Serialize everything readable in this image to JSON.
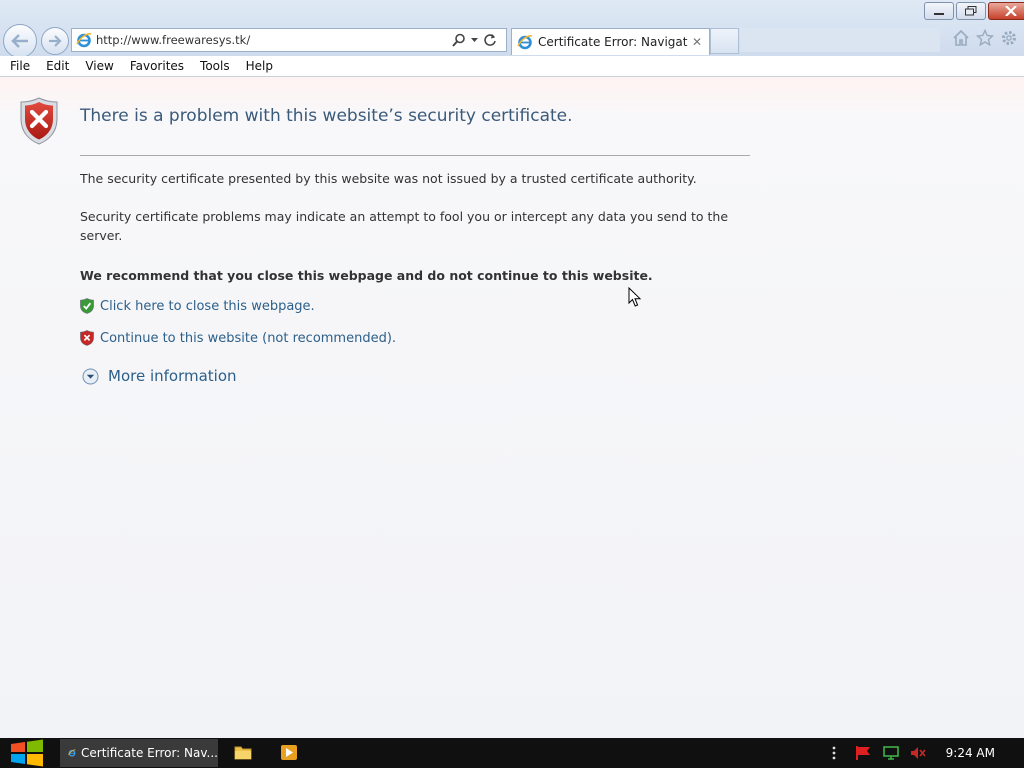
{
  "browser": {
    "address_url": "http://www.freewaresys.tk/",
    "tab_title": "Certificate Error: Navigatio...",
    "tab_close": "✕"
  },
  "menubar": {
    "items": [
      "File",
      "Edit",
      "View",
      "Favorites",
      "Tools",
      "Help"
    ]
  },
  "page": {
    "headline": "There is a problem with this website’s security certificate.",
    "paragraph1": "The security certificate presented by this website was not issued by a trusted certificate authority.",
    "paragraph2": "Security certificate problems may indicate an attempt to fool you or intercept any data you send to the server.",
    "recommendation": "We recommend that you close this webpage and do not continue to this website.",
    "close_link": "Click here to close this webpage.",
    "continue_link": "Continue to this website (not recommended).",
    "more_info": "More information"
  },
  "taskbar": {
    "ie_task_label": "Certificate Error: Nav...",
    "clock": "9:24 AM"
  },
  "colors": {
    "link": "#2b5f8a",
    "headline": "#3b5a7a",
    "error_red": "#c62828",
    "safe_green": "#3a9a3a"
  }
}
